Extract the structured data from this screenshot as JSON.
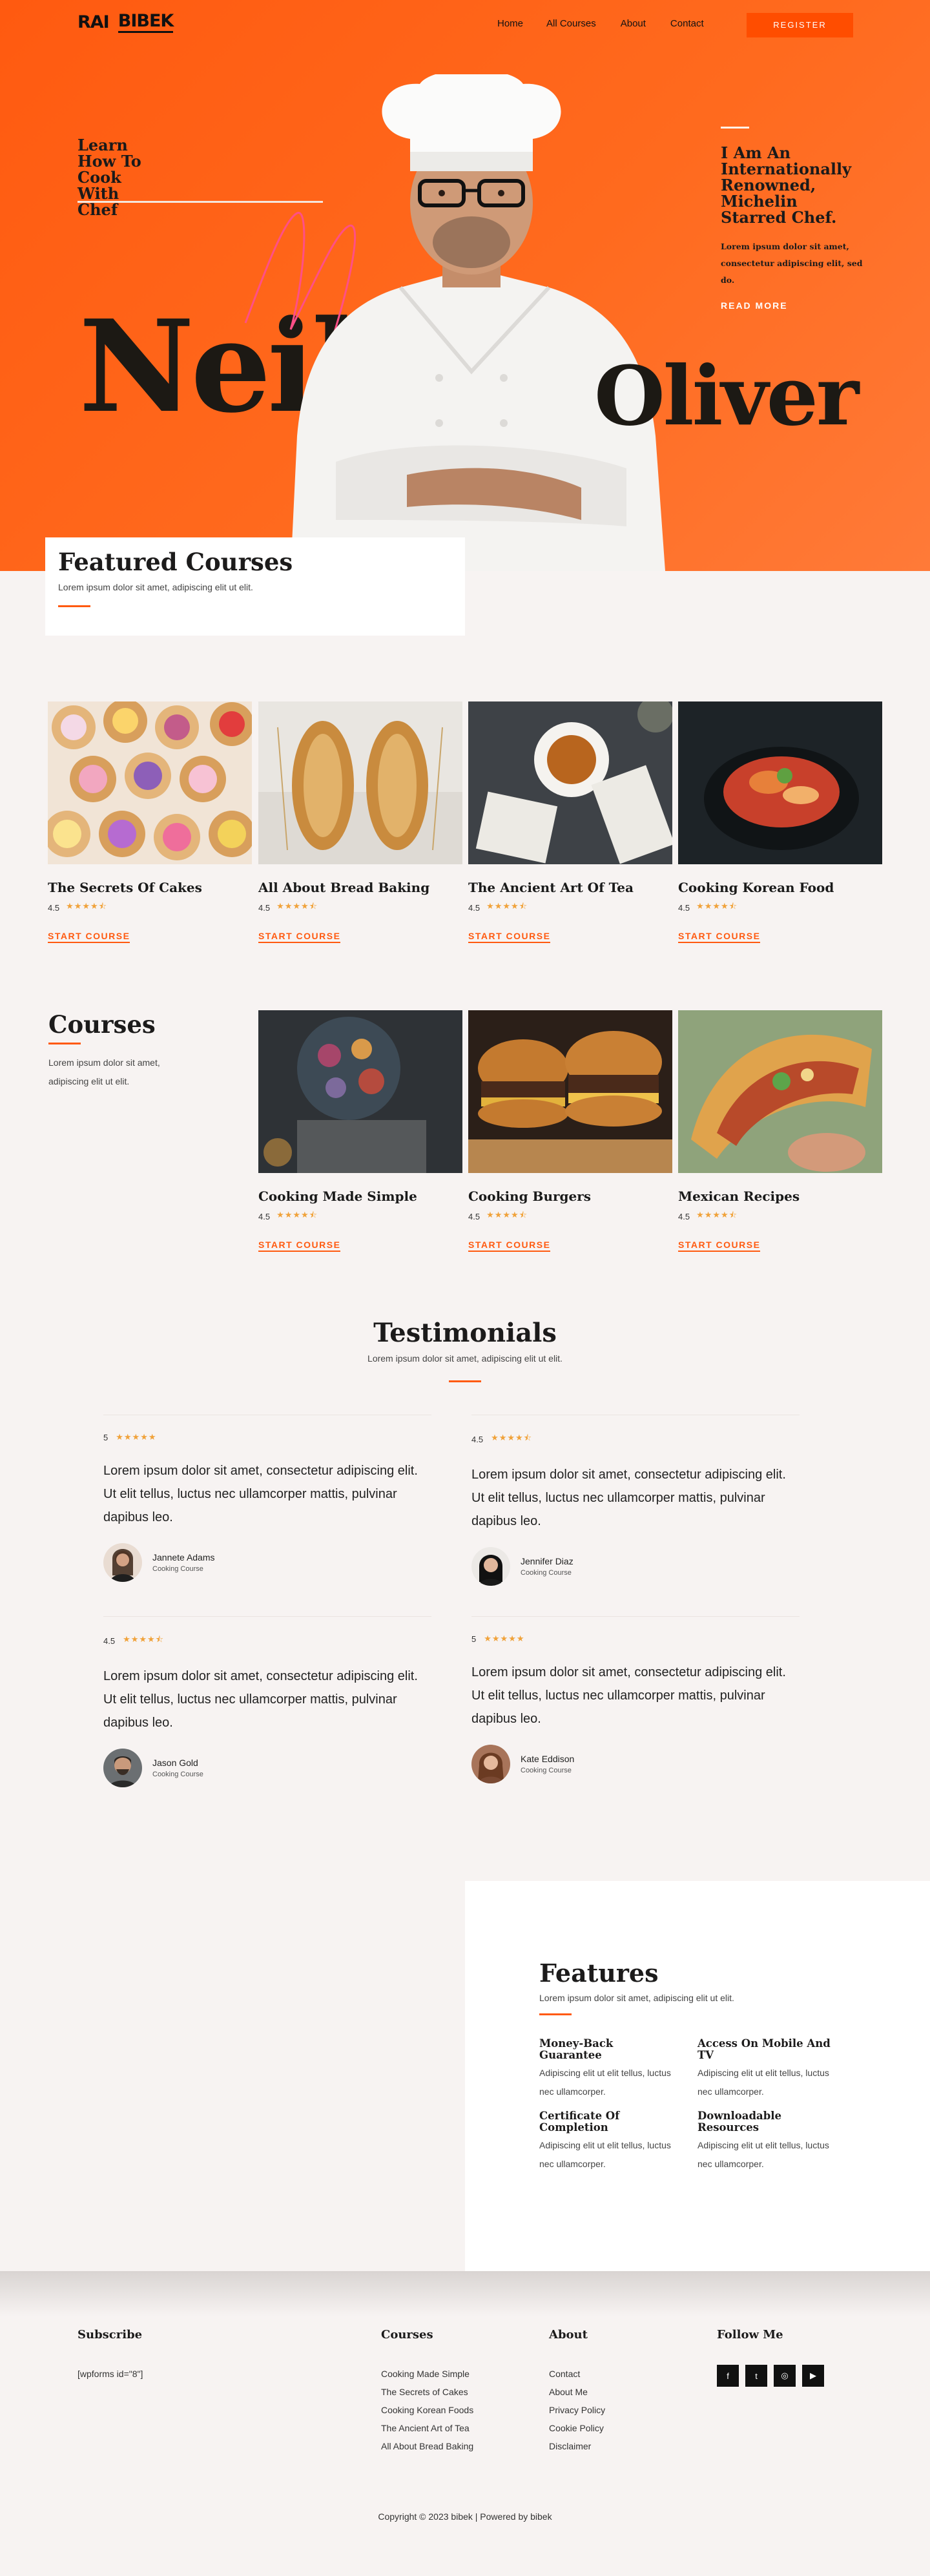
{
  "nav": {
    "logo_part1": "RAI",
    "logo_part2": "BIBEK",
    "links": [
      "Home",
      "All Courses",
      "About",
      "Contact"
    ],
    "register": "REGISTER"
  },
  "hero": {
    "learn": "Learn How To Cook With Chef",
    "first_name": "Neil",
    "last_name": "Oliver",
    "intro_title": "I Am An Internationally Renowned, Michelin Starred Chef.",
    "intro_text": "Lorem ipsum dolor sit amet, consectetur adipiscing elit, sed do.",
    "read_more": "READ MORE"
  },
  "featured": {
    "title": "Featured Courses",
    "subtitle": "Lorem ipsum dolor sit amet, adipiscing elit ut elit.",
    "cards": [
      {
        "title": "The Secrets Of Cakes",
        "rating": "4.5",
        "cta": "START COURSE"
      },
      {
        "title": "All About Bread Baking",
        "rating": "4.5",
        "cta": "START COURSE"
      },
      {
        "title": "The Ancient Art Of Tea",
        "rating": "4.5",
        "cta": "START COURSE"
      },
      {
        "title": "Cooking Korean Food",
        "rating": "4.5",
        "cta": "START COURSE"
      }
    ]
  },
  "courses": {
    "title": "Courses",
    "subtitle": "Lorem ipsum dolor sit amet, adipiscing elit ut elit.",
    "cards": [
      {
        "title": "Cooking Made Simple",
        "rating": "4.5",
        "cta": "START COURSE"
      },
      {
        "title": "Cooking Burgers",
        "rating": "4.5",
        "cta": "START COURSE"
      },
      {
        "title": "Mexican Recipes",
        "rating": "4.5",
        "cta": "START COURSE"
      }
    ]
  },
  "testimonials": {
    "title": "Testimonials",
    "subtitle": "Lorem ipsum dolor sit amet, adipiscing elit ut elit.",
    "items": [
      {
        "rating": "5",
        "quote": "Lorem ipsum dolor sit amet, consectetur adipiscing elit. Ut elit tellus, luctus nec ullamcorper mattis, pulvinar dapibus leo.",
        "name": "Jannete Adams",
        "role": "Cooking Course"
      },
      {
        "rating": "4.5",
        "quote": "Lorem ipsum dolor sit amet, consectetur adipiscing elit. Ut elit tellus, luctus nec ullamcorper mattis, pulvinar dapibus leo.",
        "name": "Jennifer Diaz",
        "role": "Cooking Course"
      },
      {
        "rating": "4.5",
        "quote": "Lorem ipsum dolor sit amet, consectetur adipiscing elit. Ut elit tellus, luctus nec ullamcorper mattis, pulvinar dapibus leo.",
        "name": "Jason Gold",
        "role": "Cooking Course"
      },
      {
        "rating": "5",
        "quote": "Lorem ipsum dolor sit amet, consectetur adipiscing elit. Ut elit tellus, luctus nec ullamcorper mattis, pulvinar dapibus leo.",
        "name": "Kate Eddison",
        "role": "Cooking Course"
      }
    ]
  },
  "features": {
    "title": "Features",
    "subtitle": "Lorem ipsum dolor sit amet, adipiscing elit ut elit.",
    "items": [
      {
        "title": "Money-Back Guarantee",
        "text": "Adipiscing elit ut elit tellus, luctus nec ullamcorper."
      },
      {
        "title": "Access On Mobile And TV",
        "text": "Adipiscing elit ut elit tellus, luctus nec ullamcorper."
      },
      {
        "title": "Certificate Of Completion",
        "text": "Adipiscing elit ut elit tellus, luctus nec ullamcorper."
      },
      {
        "title": "Downloadable Resources",
        "text": "Adipiscing elit ut elit tellus, luctus nec ullamcorper."
      }
    ]
  },
  "footer": {
    "subscribe_title": "Subscribe",
    "subscribe_shortcode": "[wpforms id=\"8\"]",
    "courses_title": "Courses",
    "courses_links": [
      "Cooking Made Simple",
      "The Secrets of Cakes",
      "Cooking Korean Foods",
      "The Ancient Art of Tea",
      "All About Bread Baking"
    ],
    "about_title": "About",
    "about_links": [
      "Contact",
      "About Me",
      "Privacy Policy",
      "Cookie Policy",
      "Disclaimer"
    ],
    "follow_title": "Follow Me",
    "social_icons": [
      "facebook-icon",
      "twitter-icon",
      "instagram-icon",
      "youtube-icon"
    ],
    "copyright": "Copyright © 2023 bibek | Powered by bibek"
  },
  "colors": {
    "accent": "#ff5a10",
    "hero_bg": "#ff6a1e",
    "star": "#f0a23a",
    "page_bg": "#f7f3f2"
  }
}
